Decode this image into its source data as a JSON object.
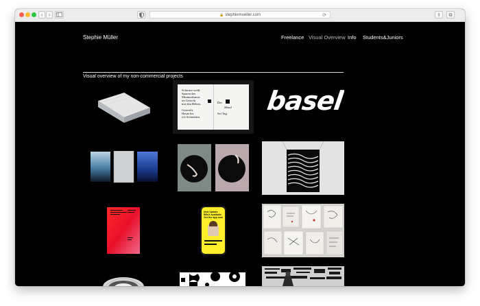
{
  "browser": {
    "url": "stephiemueller.com",
    "lock_glyph": "🔒",
    "reload_glyph": "⟳",
    "back_glyph": "‹",
    "forward_glyph": "›",
    "share_glyph": "⇪",
    "tabs_glyph": "⧉"
  },
  "site": {
    "brand": "Stephie Müller",
    "nav": [
      {
        "label": "Freelance",
        "active": false
      },
      {
        "label": "Visual Overview",
        "active": true
      },
      {
        "label": "Info",
        "active": false
      },
      {
        "label": "Students&Juniors",
        "active": false
      }
    ],
    "section_title": "Visual overview of my non-commercial projects"
  },
  "tiles": [
    {
      "name": "book-stack-thumbnail"
    },
    {
      "name": "open-book-typography-thumbnail",
      "text": {
        "left_lines": [
          "Schwarz-weiß.",
          "Spuren des",
          "Minimalismus",
          "im Gesicht",
          "mit den Beben.",
          "",
          "Gestreift.",
          "Heute bis",
          "ich Schneiden."
        ],
        "mid": [
          "Der",
          "Mond",
          "Sei Tag."
        ]
      }
    },
    {
      "name": "basel-typography-thumbnail",
      "text": {
        "word": "basel"
      }
    },
    {
      "name": "triptych-photo-thumbnail"
    },
    {
      "name": "circle-posters-thumbnail"
    },
    {
      "name": "wave-poster-thumbnail"
    },
    {
      "name": "red-poster-thumbnail"
    },
    {
      "name": "phone-app-thumbnail",
      "text": {
        "lines": [
          "New Update",
          "BEnX available.",
          "Get the app now"
        ]
      }
    },
    {
      "name": "sketchbooks-thumbnail"
    },
    {
      "name": "mirror-ball-thumbnail"
    },
    {
      "name": "pattern-shapes-thumbnail"
    },
    {
      "name": "wall-posters-thumbnail"
    }
  ]
}
